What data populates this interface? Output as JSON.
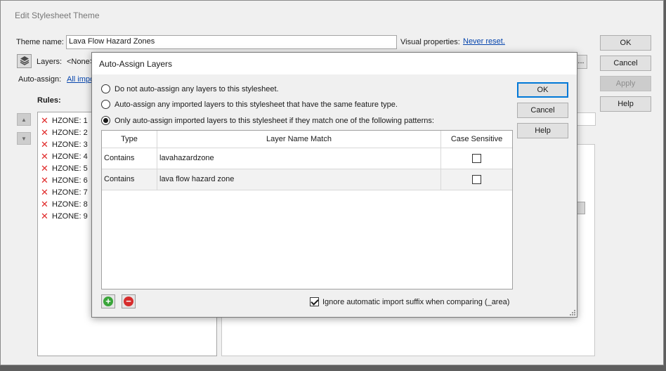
{
  "main_window": {
    "title": "Edit Stylesheet Theme",
    "theme_name_label": "Theme name:",
    "theme_name_value": "Lava Flow Hazard Zones",
    "visual_properties_label": "Visual properties:",
    "never_reset_link": "Never reset.",
    "layers_label": "Layers:",
    "layers_value": "<None>",
    "auto_assign_label": "Auto-assign:",
    "auto_assign_link": "All impo",
    "rules_label": "Rules:",
    "rules": [
      "HZONE: 1",
      "HZONE: 2",
      "HZONE: 3",
      "HZONE: 4",
      "HZONE: 5",
      "HZONE: 6",
      "HZONE: 7",
      "HZONE: 8",
      "HZONE: 9"
    ],
    "ok_label": "OK",
    "cancel_label": "Cancel",
    "apply_label": "Apply",
    "help_label": "Help",
    "ellipsis_label": "..."
  },
  "dialog": {
    "title": "Auto-Assign Layers",
    "options": [
      {
        "label": "Do not auto-assign any layers to this stylesheet.",
        "selected": false
      },
      {
        "label": "Auto-assign any imported layers to this stylesheet that have the same feature type.",
        "selected": false
      },
      {
        "label": "Only auto-assign imported layers to this stylesheet if they match one of the following patterns:",
        "selected": true
      }
    ],
    "table": {
      "headers": {
        "type": "Type",
        "match": "Layer Name Match",
        "case": "Case Sensitive"
      },
      "rows": [
        {
          "type": "Contains",
          "match": "lavahazardzone",
          "case_sensitive": false
        },
        {
          "type": "Contains",
          "match": "lava flow hazard zone",
          "case_sensitive": false
        }
      ]
    },
    "ignore_suffix_label": "Ignore automatic import suffix when comparing (_area)",
    "ignore_suffix_checked": true,
    "ok_label": "OK",
    "cancel_label": "Cancel",
    "help_label": "Help"
  },
  "colors": {
    "link": "#0645ad",
    "accent_border": "#0078d7",
    "delete_x": "#e02b2b",
    "add_green": "#3aa53a",
    "remove_red": "#d62c2c"
  }
}
